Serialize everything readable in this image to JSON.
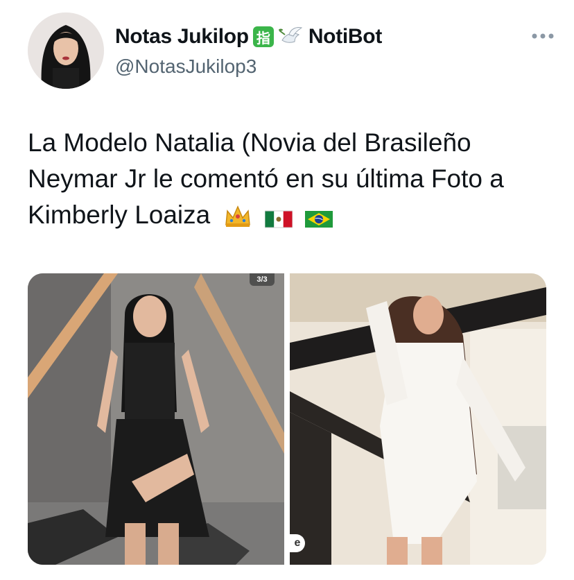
{
  "author": {
    "display_name": "Notas Jukilop",
    "badge_text": "指",
    "bot_name": "NotiBot",
    "handle": "@NotasJukilop3"
  },
  "icons": {
    "avatar": "avatar-photo",
    "verified_badge": "finger-badge-icon",
    "bot_badge": "dove-icon",
    "more": "more-options-icon"
  },
  "tweet": {
    "text": "La Modelo Natalia (Novia del Brasileño Neymar Jr le comentó en su última Foto a Kimberly Loaiza",
    "emojis": [
      "crown",
      "mexico-flag",
      "brazil-flag"
    ]
  },
  "media": {
    "photo_left_counter": "3/3",
    "photo_right_tag": "e"
  },
  "colors": {
    "text": "#0f1419",
    "secondary": "#536471",
    "badge_green": "#3bb54a"
  }
}
